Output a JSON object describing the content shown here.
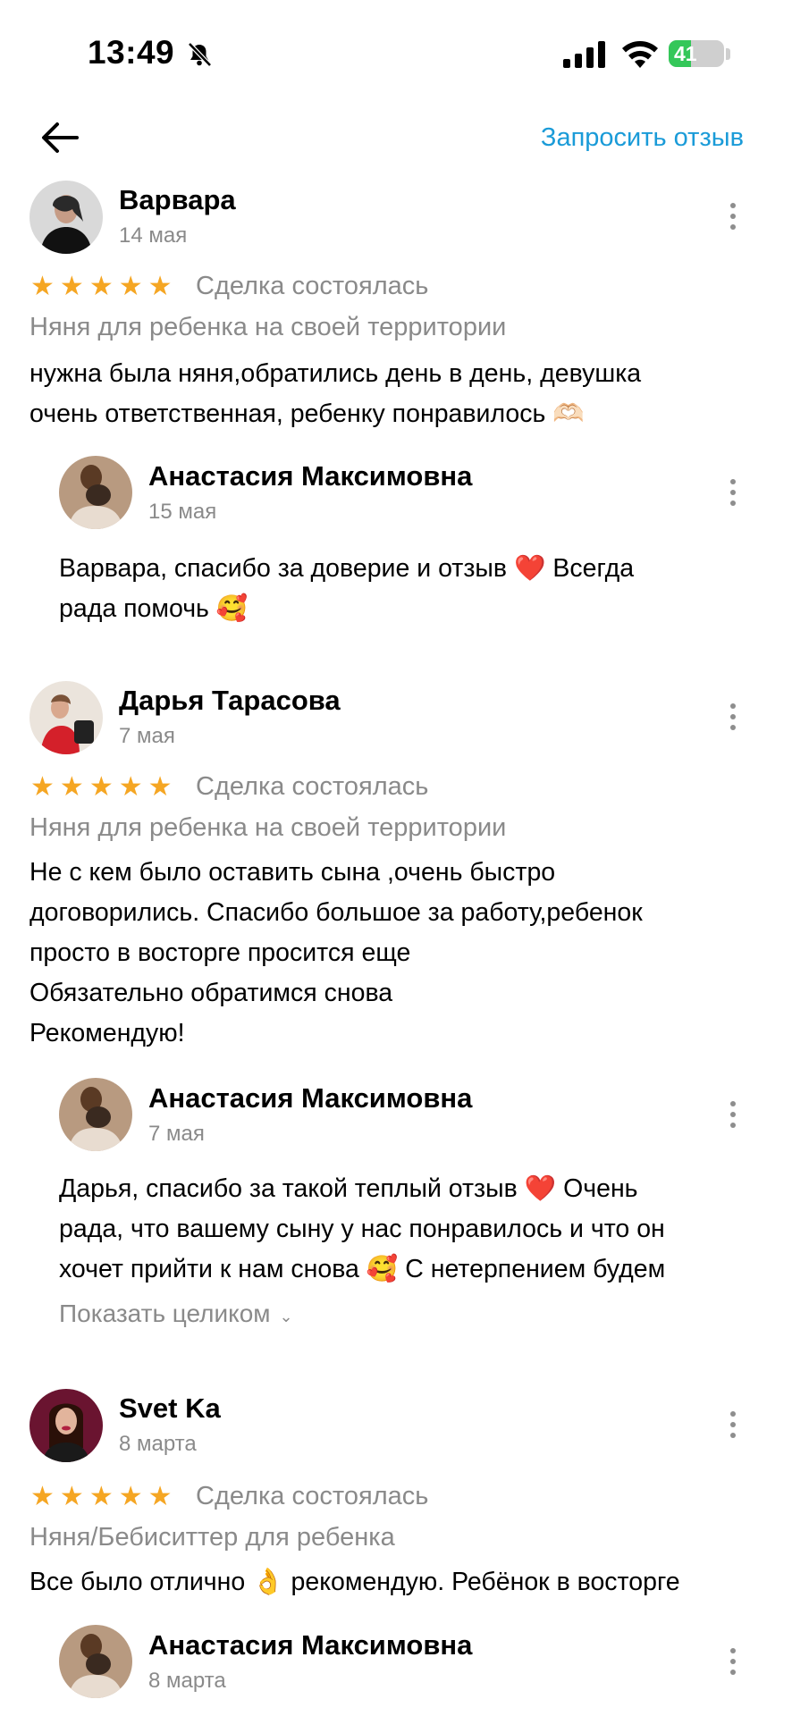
{
  "status_bar": {
    "time": "13:49",
    "battery": "41",
    "battery_level": 0.41
  },
  "header": {
    "request_review": "Запросить отзыв"
  },
  "reviews": [
    {
      "name": "Варвара",
      "date": "14 мая",
      "rating": 5,
      "deal": "Сделка состоялась",
      "service": "Няня для ребенка на своей территории",
      "text": "нужна была няня,обратились день в день, девушка\nочень ответственная, ребенку понравилось 🫶🏻",
      "reply": {
        "name": "Анастасия Максимовна",
        "date": "15 мая",
        "text": "Варвара, спасибо за доверие и отзыв ❤️ Всегда\nрада помочь 🥰"
      }
    },
    {
      "name": "Дарья Тарасова",
      "date": "7 мая",
      "rating": 5,
      "deal": "Сделка состоялась",
      "service": "Няня для ребенка на своей территории",
      "text": "Не с кем было оставить сына ,очень быстро\nдоговорились. Спасибо большое за работу,ребенок\nпросто в восторге просится еще\nОбязательно обратимся снова\nРекомендую!",
      "reply": {
        "name": "Анастасия Максимовна",
        "date": "7 мая",
        "text": "Дарья, спасибо за такой теплый отзыв ❤️ Очень\nрада, что вашему сыну у нас понравилось и что он\nхочет прийти к нам снова 🥰 С нетерпением будем",
        "show_more": "Показать целиком"
      }
    },
    {
      "name": "Svet Ka",
      "date": "8 марта",
      "rating": 5,
      "deal": "Сделка состоялась",
      "service": "Няня/Бебиситтер для ребенка",
      "text": "Все было отлично 👌 рекомендую. Ребёнок в восторге",
      "reply": {
        "name": "Анастасия Максимовна",
        "date": "8 марта"
      }
    }
  ],
  "icons": {
    "star": "★",
    "chevron": "⌄",
    "colors": {
      "star": "#f5a623",
      "link": "#1a9bd8",
      "muted": "#8a8a8a",
      "battery": "#34c759"
    }
  }
}
